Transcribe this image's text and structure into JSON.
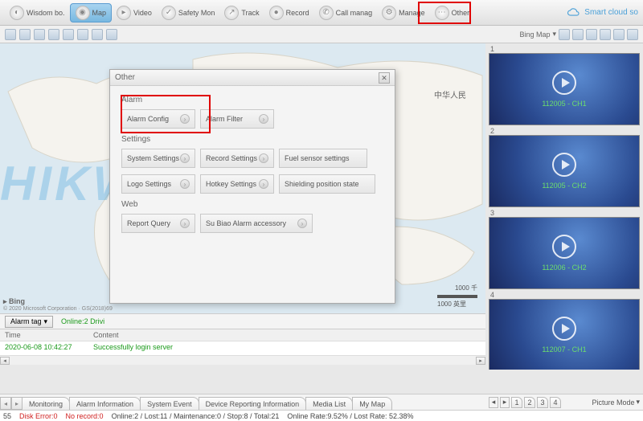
{
  "topbar": {
    "items": [
      {
        "label": "Wisdom bo."
      },
      {
        "label": "Map",
        "active": true
      },
      {
        "label": "Video"
      },
      {
        "label": "Safety Mon"
      },
      {
        "label": "Track"
      },
      {
        "label": "Record"
      },
      {
        "label": "Call manag"
      },
      {
        "label": "Manage"
      },
      {
        "label": "Other"
      }
    ],
    "brand": "Smart cloud so"
  },
  "secbar": {
    "map_source": "Bing Map"
  },
  "map": {
    "watermark": "HIKWAY",
    "bing_label": "Bing",
    "copyright": "© 2020 Microsoft Corporation · GS(2018)69",
    "scale_top": "1000 千",
    "scale_bottom": "1000 英里",
    "cn_label": "中华人民"
  },
  "tagrow": {
    "alarm_tag": "Alarm tag",
    "online": "Online:2 Drivi"
  },
  "log": {
    "col_time": "Time",
    "col_content": "Content",
    "row_time": "2020-06-08 10:42:27",
    "row_content": "Successfully login server"
  },
  "dialog": {
    "title": "Other",
    "sections": {
      "alarm": "Alarm",
      "settings": "Settings",
      "web": "Web"
    },
    "buttons": {
      "alarm_config": "Alarm Config",
      "alarm_filter": "Alarm Filter",
      "system_settings": "System Settings",
      "record_settings": "Record Settings",
      "fuel_sensor": "Fuel sensor settings",
      "logo_settings": "Logo Settings",
      "hotkey_settings": "Hotkey Settings",
      "shielding": "Shielding position state",
      "report_query": "Report Query",
      "su_biao": "Su Biao Alarm accessory"
    }
  },
  "thumbs": [
    {
      "num": "1",
      "label": "112005 - CH1"
    },
    {
      "num": "2",
      "label": "112005 - CH2"
    },
    {
      "num": "3",
      "label": "112006 - CH2"
    },
    {
      "num": "4",
      "label": "112007 - CH1"
    }
  ],
  "tabs": [
    "Monitoring",
    "Alarm Information",
    "System Event",
    "Device Reporting Information",
    "Media List",
    "My Map"
  ],
  "picnav": {
    "pages": [
      "1",
      "2",
      "3",
      "4"
    ],
    "mode": "Picture Mode"
  },
  "status": {
    "left": "55",
    "disk": "Disk Error:0",
    "norec": "No record:0",
    "counts": "Online:2 / Lost:11 / Maintenance:0 / Stop:8 / Total:21",
    "rates": "Online Rate:9.52% / Lost Rate: 52.38%"
  }
}
